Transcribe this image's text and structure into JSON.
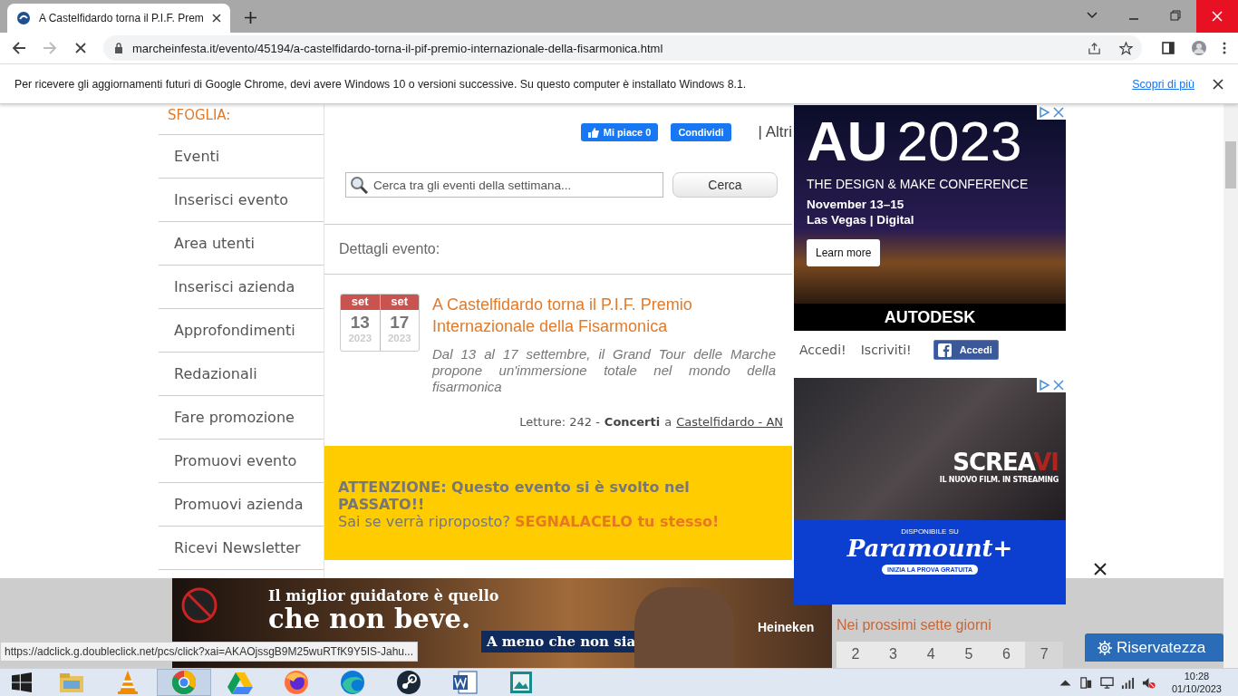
{
  "browser": {
    "tab_title": "A Castelfidardo torna il P.I.F. Prem",
    "url": "marcheinfesta.it/evento/45194/a-castelfidardo-torna-il-pif-premio-internazionale-della-fisarmonica.html",
    "infobar": {
      "message": "Per ricevere gli aggiornamenti futuri di Google Chrome, devi avere Windows 10 o versioni successive. Su questo computer è installato Windows 8.1.",
      "link": "Scopri di più"
    }
  },
  "sidebar": {
    "heading": "SFOGLIA:",
    "items": [
      "Eventi",
      "Inserisci evento",
      "Area utenti",
      "Inserisci azienda",
      "Approfondimenti",
      "Redazionali",
      "Fare promozione",
      "Promuovi evento",
      "Promuovi azienda",
      "Ricevi Newsletter"
    ]
  },
  "social": {
    "like": "Mi piace 0",
    "share": "Condividi",
    "more": "| Altri"
  },
  "search": {
    "placeholder": "Cerca tra gli eventi della settimana...",
    "button": "Cerca"
  },
  "section_title": "Dettagli evento:",
  "event": {
    "dates": [
      {
        "month": "set",
        "day": "13",
        "year": "2023"
      },
      {
        "month": "set",
        "day": "17",
        "year": "2023"
      }
    ],
    "title": "A Castelfidardo torna il P.I.F. Premio Internazionale della Fisarmonica",
    "description": "Dal 13 al 17 settembre, il Grand Tour delle Marche propone un'immersione totale nel mondo della fisarmonica",
    "reads": "Letture: 242 -",
    "category": "Concerti",
    "connector": "a",
    "place": "Castelfidardo - AN"
  },
  "notice": {
    "warning": "ATTENZIONE: Questo evento si è svolto nel PASSATO!!",
    "question": "Sai se verrà riproposto?",
    "action": "SEGNALACELO tu stesso!"
  },
  "ad_conference": {
    "headline": "AU",
    "year": "2023",
    "tagline": "THE DESIGN & MAKE CONFERENCE",
    "date": "November 13–15",
    "place": "Las Vegas | Digital",
    "button": "Learn more",
    "brand": "AUTODESK"
  },
  "login": {
    "sign_in": "Accedi!",
    "register": "Iscriviti!",
    "facebook": "Accedi"
  },
  "ad_film": {
    "title": "SCREA",
    "numeral": "VI",
    "subtitle": "IL NUOVO FILM. IN STREAMING",
    "available": "DISPONIBILE SU",
    "service": "Paramount+",
    "cta": "INIZIA LA PROVA GRATUITA"
  },
  "ad_bottom": {
    "line1": "Il miglior guidatore è quello",
    "line2": "che non beve.",
    "line3": "A meno che non sia",
    "brand": "Heineken"
  },
  "calendar": {
    "title": "Nei prossimi sette giorni",
    "days": [
      {
        "label": "2",
        "selected": false
      },
      {
        "label": "3",
        "selected": false
      },
      {
        "label": "4",
        "selected": false
      },
      {
        "label": "5",
        "selected": false
      },
      {
        "label": "6",
        "selected": false
      },
      {
        "label": "7",
        "selected": true
      }
    ]
  },
  "privacy_button": "Riservatezza",
  "status_url": "https://adclick.g.doubleclick.net/pcs/click?xai=AKAOjssgB9M25wuRTfK9Y5IS-Jahu...",
  "taskbar": {
    "apps": [
      {
        "kind": "explorer",
        "selected": false
      },
      {
        "kind": "vlc",
        "selected": false
      },
      {
        "kind": "chrome",
        "selected": true
      },
      {
        "kind": "drive",
        "selected": false
      },
      {
        "kind": "firefox",
        "selected": false
      },
      {
        "kind": "edge",
        "selected": false
      },
      {
        "kind": "steam",
        "selected": false
      },
      {
        "kind": "word",
        "selected": false
      },
      {
        "kind": "photos",
        "selected": false
      }
    ],
    "time": "10:28",
    "date": "01/10/2023"
  }
}
